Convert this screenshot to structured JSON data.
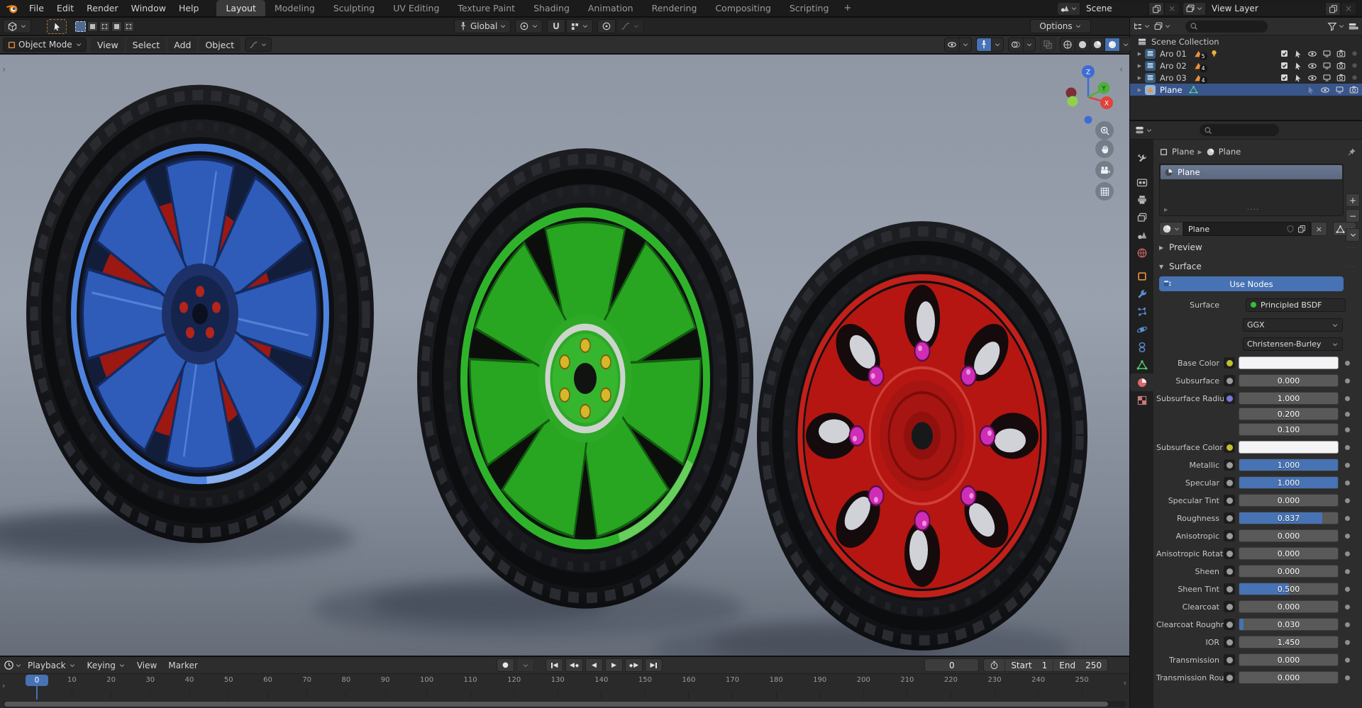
{
  "colors": {
    "accent": "#4772b3"
  },
  "icons": {
    "disclosure": "▶",
    "expanded": "▼",
    "collapsed": "▶",
    "close": "×",
    "plus": "+",
    "minus": "−",
    "record": "●",
    "play": "▶",
    "play_back": "◀",
    "keyframe": "◆",
    "grip": "····",
    "panel_open_right": "›",
    "panel_close": "‹"
  },
  "topbar": {
    "menus": [
      "File",
      "Edit",
      "Render",
      "Window",
      "Help"
    ],
    "tabs": [
      {
        "label": "Layout",
        "active": true
      },
      {
        "label": "Modeling"
      },
      {
        "label": "Sculpting"
      },
      {
        "label": "UV Editing"
      },
      {
        "label": "Texture Paint"
      },
      {
        "label": "Shading"
      },
      {
        "label": "Animation"
      },
      {
        "label": "Rendering"
      },
      {
        "label": "Compositing"
      },
      {
        "label": "Scripting"
      }
    ],
    "new_tab": "+",
    "scene": {
      "label": "Scene"
    },
    "view_layer": {
      "label": "View Layer"
    }
  },
  "tool_settings": {
    "orientation": "Global",
    "options": "Options"
  },
  "viewport": {
    "mode": "Object Mode",
    "menus": [
      "View",
      "Select",
      "Add",
      "Object"
    ],
    "gizmo": {
      "x": "X",
      "y": "Y",
      "z": "Z"
    },
    "objects": [
      {
        "name": "wheel-blue",
        "rim": "#2e5cb8"
      },
      {
        "name": "wheel-green",
        "rim": "#28a621"
      },
      {
        "name": "wheel-red",
        "rim": "#b51611"
      }
    ]
  },
  "outliner": {
    "root": "Scene Collection",
    "items": [
      {
        "label": "Aro 01",
        "collection": true,
        "badge": "5",
        "bulb": true,
        "check": true,
        "extra": true
      },
      {
        "label": "Aro 02",
        "collection": true,
        "badge": "4",
        "check": true,
        "extra": true
      },
      {
        "label": "Aro 03",
        "collection": true,
        "badge": "4",
        "check": true,
        "extra": true
      },
      {
        "label": "Plane",
        "mesh": true,
        "meshdata": true,
        "selected": true,
        "cursor_faded": true
      }
    ]
  },
  "properties": {
    "breadcrumb": {
      "object": "Plane",
      "data": "Plane"
    },
    "slot_name": "Plane",
    "material_name": "Plane",
    "preview_panel": "Preview",
    "surface_panel": "Surface",
    "use_nodes": "Use Nodes",
    "surface_label": "Surface",
    "surface_shader": "Principled BSDF",
    "distribution": "GGX",
    "subsurface_method": "Christensen-Burley",
    "rows": [
      {
        "label": "Base Color",
        "socket": "#bfbf2e",
        "color": true
      },
      {
        "label": "Subsurface",
        "socket": "#9b9b9b",
        "value": "0.000",
        "fill": 0
      },
      {
        "label": "Subsurface Radius",
        "socket": "#7a76d6",
        "value": "1.000",
        "fill": 0
      },
      {
        "label": "",
        "value": "0.200",
        "fill": 0,
        "sub": true
      },
      {
        "label": "",
        "value": "0.100",
        "fill": 0,
        "sub": true
      },
      {
        "label": "Subsurface Color",
        "socket": "#bfbf2e",
        "color": true
      },
      {
        "label": "Metallic",
        "socket": "#9b9b9b",
        "value": "1.000",
        "fill": 100
      },
      {
        "label": "Specular",
        "socket": "#9b9b9b",
        "value": "1.000",
        "fill": 100
      },
      {
        "label": "Specular Tint",
        "socket": "#9b9b9b",
        "value": "0.000",
        "fill": 0
      },
      {
        "label": "Roughness",
        "socket": "#9b9b9b",
        "value": "0.837",
        "fill": 84
      },
      {
        "label": "Anisotropic",
        "socket": "#9b9b9b",
        "value": "0.000",
        "fill": 0
      },
      {
        "label": "Anisotropic Rotati...",
        "socket": "#9b9b9b",
        "value": "0.000",
        "fill": 0
      },
      {
        "label": "Sheen",
        "socket": "#9b9b9b",
        "value": "0.000",
        "fill": 0
      },
      {
        "label": "Sheen Tint",
        "socket": "#9b9b9b",
        "value": "0.500",
        "fill": 50
      },
      {
        "label": "Clearcoat",
        "socket": "#9b9b9b",
        "value": "0.000",
        "fill": 0
      },
      {
        "label": "Clearcoat Roughn...",
        "socket": "#9b9b9b",
        "value": "0.030",
        "fill": 4
      },
      {
        "label": "IOR",
        "socket": "#9b9b9b",
        "value": "1.450",
        "fill": 0
      },
      {
        "label": "Transmission",
        "socket": "#9b9b9b",
        "value": "0.000",
        "fill": 0
      },
      {
        "label": "Transmission Roug...",
        "socket": "#9b9b9b",
        "value": "0.000",
        "fill": 0
      }
    ]
  },
  "timeline": {
    "menus": [
      {
        "label": "Playback",
        "chev": true
      },
      {
        "label": "Keying",
        "chev": true
      },
      {
        "label": "View"
      },
      {
        "label": "Marker"
      }
    ],
    "current_frame": "0",
    "start_label": "Start",
    "start_value": "1",
    "end_label": "End",
    "end_value": "250",
    "ticks": [
      "10",
      "20",
      "30",
      "40",
      "50",
      "60",
      "70",
      "80",
      "90",
      "100",
      "110",
      "120",
      "130",
      "140",
      "150",
      "160",
      "170",
      "180",
      "190",
      "200",
      "210",
      "220",
      "230",
      "240",
      "250"
    ]
  }
}
